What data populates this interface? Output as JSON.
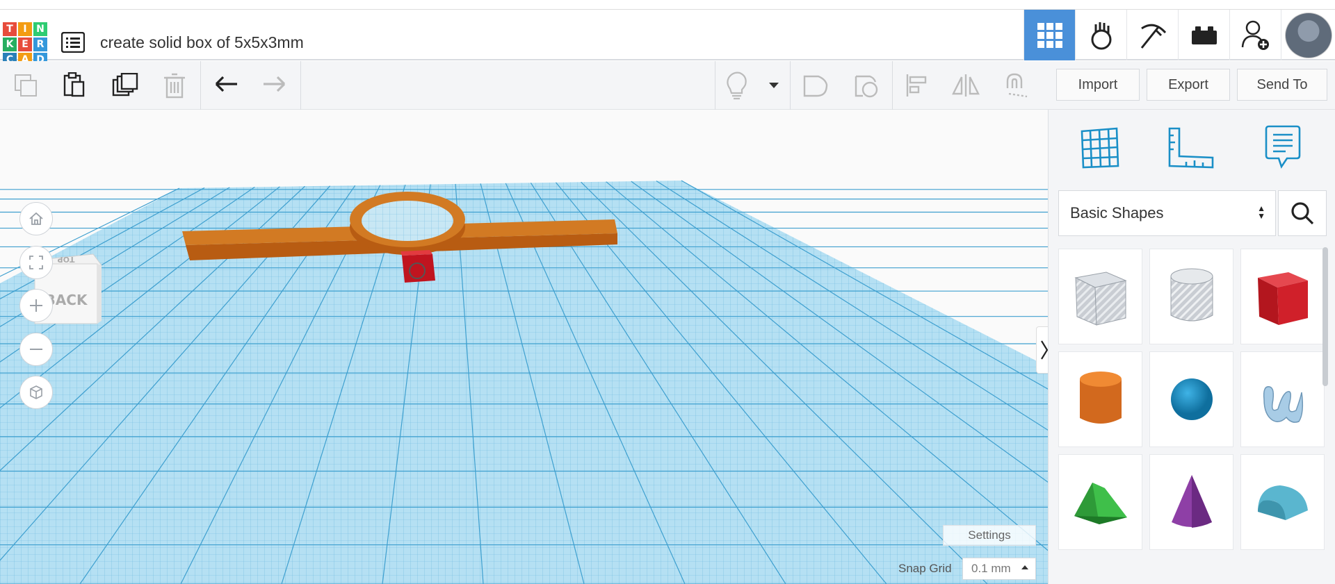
{
  "app": {
    "logo_letters": [
      "T",
      "I",
      "N",
      "K",
      "E",
      "R",
      "C",
      "A",
      "D"
    ],
    "logo_colors": [
      "#e74c3c",
      "#f39c12",
      "#2ecc71",
      "#27ae60",
      "#e74c3c",
      "#3498db",
      "#2980b9",
      "#f39c12",
      "#3498db"
    ],
    "design_title": "create solid box of 5x5x3mm"
  },
  "header_icons": [
    {
      "name": "3d-design-grid-icon",
      "active": true
    },
    {
      "name": "circuits-icon",
      "active": false
    },
    {
      "name": "codeblocks-pickaxe-icon",
      "active": false
    },
    {
      "name": "bricks-icon",
      "active": false
    },
    {
      "name": "invite-user-icon",
      "active": false
    }
  ],
  "toolbar": {
    "import_label": "Import",
    "export_label": "Export",
    "sendto_label": "Send To"
  },
  "viewcube": {
    "front_label": "BACK",
    "top_label": "TOP"
  },
  "panel": {
    "category": "Basic Shapes",
    "shapes": [
      {
        "name": "box-hole-shape"
      },
      {
        "name": "cylinder-hole-shape"
      },
      {
        "name": "box-shape"
      },
      {
        "name": "cylinder-shape"
      },
      {
        "name": "sphere-shape"
      },
      {
        "name": "scribble-shape"
      },
      {
        "name": "roof-shape"
      },
      {
        "name": "cone-shape"
      },
      {
        "name": "round-roof-shape"
      }
    ]
  },
  "workplane": {
    "settings_label": "Settings",
    "snap_grid_label": "Snap Grid",
    "snap_grid_value": "0.1 mm"
  },
  "colors": {
    "accent": "#4a90d9",
    "workplane": "#7ec8ea",
    "orange_part": "#d2691e",
    "red_box": "#d0202a"
  }
}
